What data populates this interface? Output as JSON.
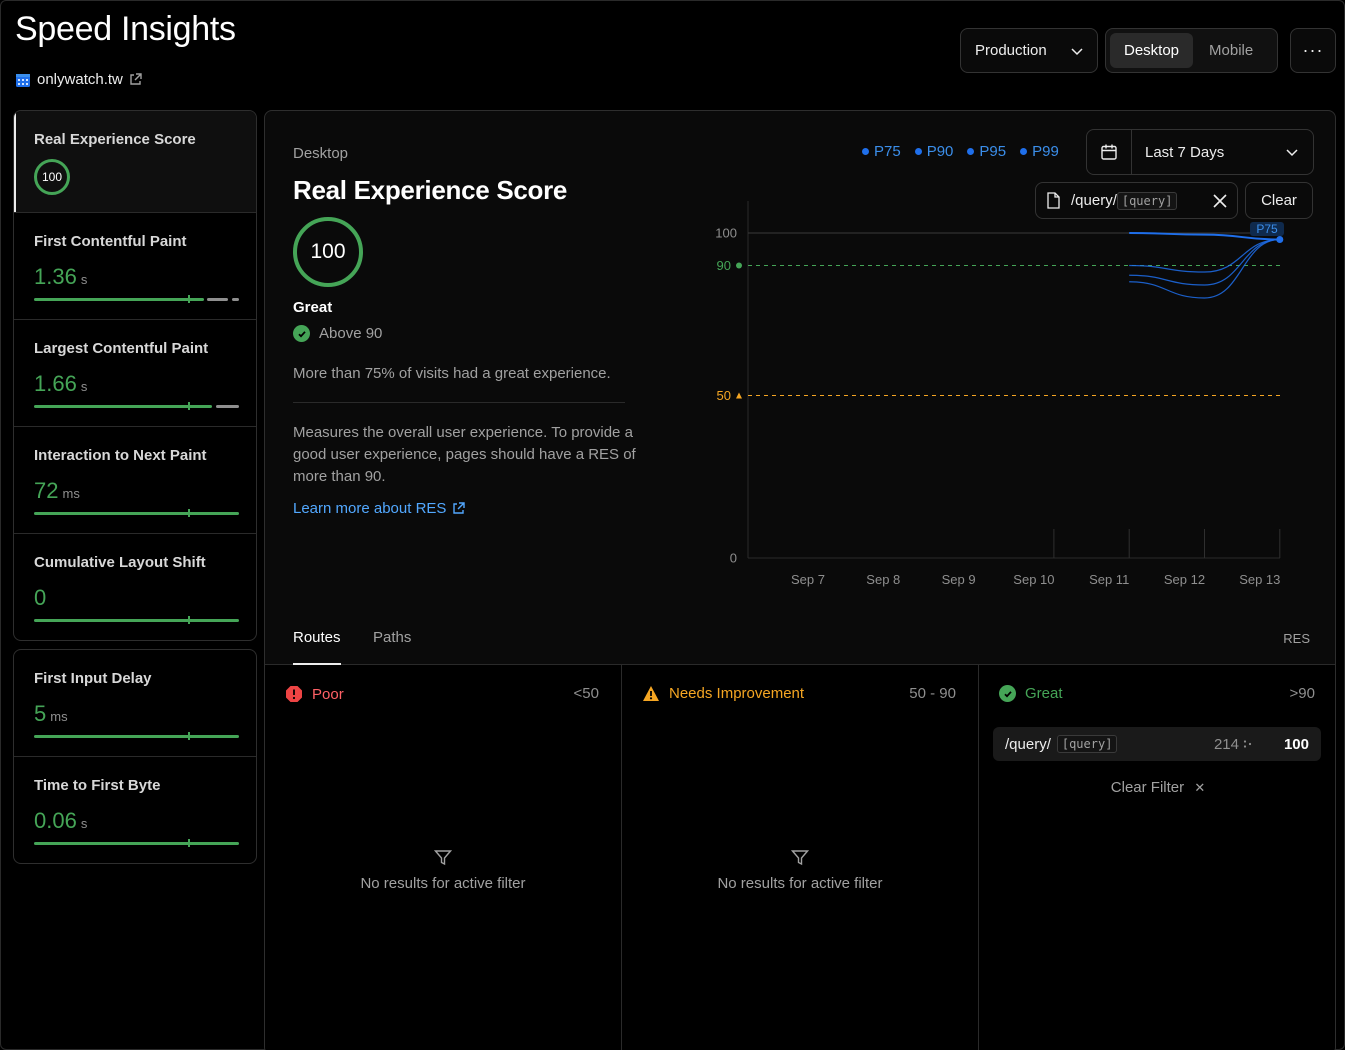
{
  "header": {
    "title": "Speed Insights",
    "site": "onlywatch.tw",
    "environment": "Production",
    "devices": [
      "Desktop",
      "Mobile"
    ],
    "active_device": "Desktop",
    "more": "···"
  },
  "sidebar": {
    "group1": [
      {
        "label": "Real Experience Score",
        "score": "100"
      },
      {
        "label": "First Contentful Paint",
        "value": "1.36",
        "unit": "s"
      },
      {
        "label": "Largest Contentful Paint",
        "value": "1.66",
        "unit": "s"
      },
      {
        "label": "Interaction to Next Paint",
        "value": "72",
        "unit": "ms"
      },
      {
        "label": "Cumulative Layout Shift",
        "value": "0",
        "unit": ""
      }
    ],
    "group2": [
      {
        "label": "First Input Delay",
        "value": "5",
        "unit": "ms"
      },
      {
        "label": "Time to First Byte",
        "value": "0.06",
        "unit": "s"
      }
    ]
  },
  "main": {
    "device": "Desktop",
    "title": "Real Experience Score",
    "score": "100",
    "rating": "Great",
    "threshold": "Above 90",
    "visits": "More than 75% of visits had a great experience.",
    "description": "Measures the overall user experience. To provide a good user experience, pages should have a RES of more than 90.",
    "learn_more": "Learn more about RES",
    "legend": [
      "P75",
      "P90",
      "P95",
      "P99"
    ],
    "date_range": "Last 7 Days",
    "filter_path": "/query/",
    "filter_param": "[query]",
    "clear": "Clear"
  },
  "chart_data": {
    "type": "line",
    "x": [
      "Sep 7",
      "Sep 8",
      "Sep 9",
      "Sep 10",
      "Sep 11",
      "Sep 12",
      "Sep 13"
    ],
    "ylim": [
      0,
      100
    ],
    "yticks": [
      "100",
      "90",
      "50",
      "0"
    ],
    "thresholds": [
      {
        "value": 90,
        "color": "#45a557"
      },
      {
        "value": 50,
        "color": "#f5a623"
      }
    ],
    "series": [
      {
        "name": "P75",
        "values": [
          null,
          null,
          null,
          null,
          100,
          99.5,
          98
        ]
      },
      {
        "name": "P90",
        "values": [
          null,
          null,
          null,
          null,
          90,
          88,
          98
        ]
      },
      {
        "name": "P95",
        "values": [
          null,
          null,
          null,
          null,
          87,
          84,
          98
        ]
      },
      {
        "name": "P99",
        "values": [
          null,
          null,
          null,
          null,
          85,
          80,
          98
        ]
      }
    ],
    "point_label": "P75",
    "color": "#1f6feb"
  },
  "tabs": {
    "items": [
      "Routes",
      "Paths"
    ],
    "active": "Routes",
    "metric": "RES"
  },
  "columns": {
    "poor": {
      "label": "Poor",
      "range": "<50",
      "empty": "No results for active filter"
    },
    "needs": {
      "label": "Needs Improvement",
      "range": "50 - 90",
      "empty": "No results for active filter"
    },
    "great": {
      "label": "Great",
      "range": ">90",
      "row_path": "/query/",
      "row_param": "[query]",
      "row_count": "214",
      "row_score": "100",
      "clear_filter": "Clear Filter"
    }
  },
  "colors": {
    "great": "#45a557",
    "needs": "#f5a623",
    "poor": "#ee4444",
    "accent": "#52a8ff"
  }
}
